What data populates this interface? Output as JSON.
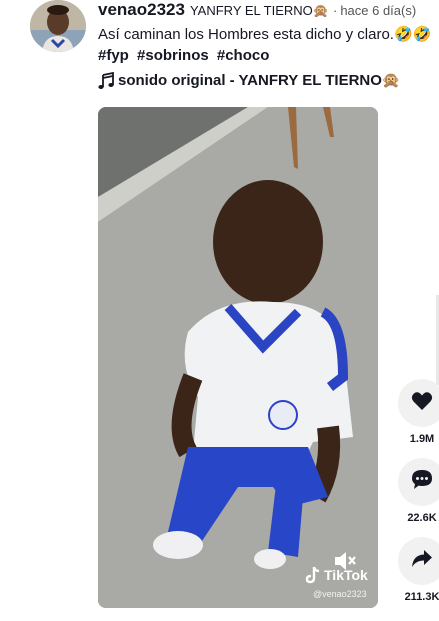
{
  "author": {
    "username": "venao2323",
    "nickname": "YANFRY EL TIERNO🙊",
    "separator": "·",
    "time": "hace 6 día(s)"
  },
  "caption": {
    "text": "Así caminan los Hombres esta dicho y claro.🤣🤣",
    "hashtags": [
      "#fyp",
      "#sobrinos",
      "#choco"
    ]
  },
  "music": {
    "icon": "music-note-icon",
    "title": "sonido original - YANFRY EL TIERNO🙊"
  },
  "video": {
    "watermark_brand": "TikTok",
    "watermark_handle": "@venao2323",
    "mute_icon": "speaker-muted-icon"
  },
  "actions": {
    "likes": "1.9M",
    "comments": "22.6K",
    "shares": "211.3K"
  },
  "colors": {
    "text": "#161823",
    "button_bg": "#f1f1f2"
  }
}
